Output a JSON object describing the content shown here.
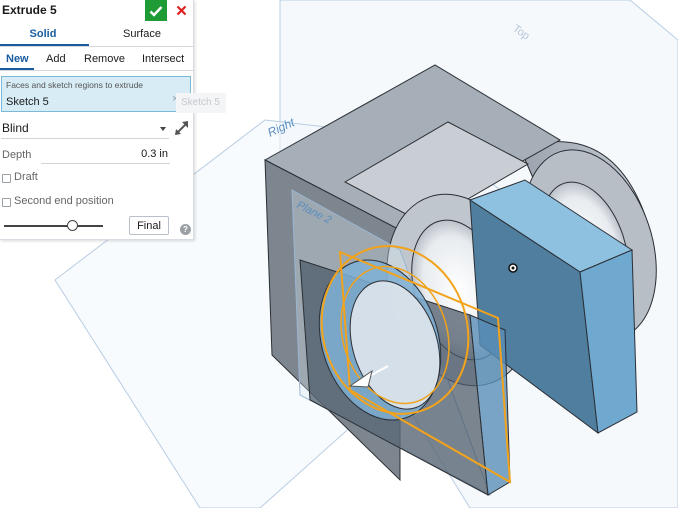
{
  "dialog": {
    "title": "Extrude 5",
    "ok_icon": "check-icon",
    "cancel_icon": "close-icon",
    "creation_types": [
      "Solid",
      "Surface"
    ],
    "active_creation_type": "Solid",
    "operations": [
      "New",
      "Add",
      "Remove",
      "Intersect"
    ],
    "active_operation": "New",
    "selection_hint": "Faces and sketch regions to extrude",
    "selection_item": "Sketch 5",
    "selection_remove": "×",
    "selection_ghost": "Sketch 5",
    "end_type": "Blind",
    "flip_icon": "flip-direction-icon",
    "depth_label": "Depth",
    "depth_value": "0.3 in",
    "draft_label": "Draft",
    "second_end_label": "Second end position",
    "final_label": "Final",
    "help_icon": "?",
    "preview_slider_fraction": 0.7
  },
  "viewport": {
    "plane_labels": [
      "Top",
      "Right",
      "Plane 2"
    ]
  },
  "colors": {
    "accent": "#1a5c9e",
    "ok_green": "#1f9b35",
    "cancel_red": "#e02020",
    "selection_bg": "#d7ecf5",
    "sketch_orange": "#f2a31b",
    "part_gray": "#8c95a0",
    "part_blue": "#6aa7d0"
  }
}
